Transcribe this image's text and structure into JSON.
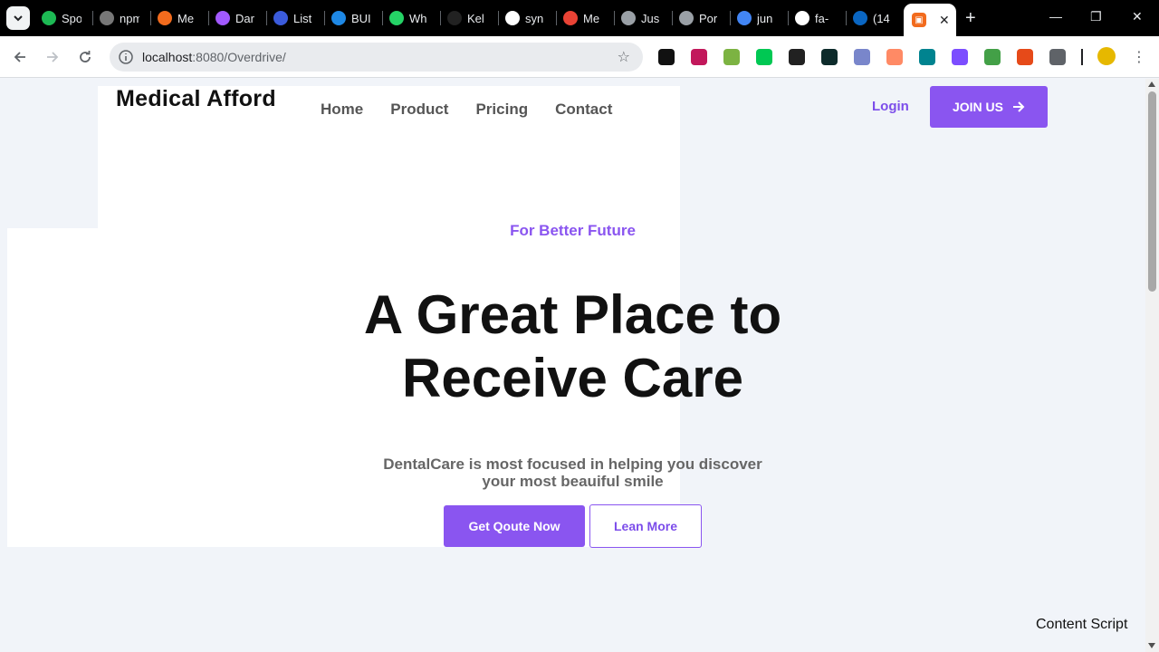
{
  "browser": {
    "tabs": [
      {
        "label": "Spo",
        "icon": "spotify-icon",
        "color": "#1db954"
      },
      {
        "label": "npm",
        "icon": "npm-icon",
        "color": "#777777"
      },
      {
        "label": "Me",
        "icon": "asterisk-icon",
        "color": "#f26b1d"
      },
      {
        "label": "Dar",
        "icon": "vite-icon",
        "color": "#a259ff"
      },
      {
        "label": "List",
        "icon": "droplet-icon",
        "color": "#3b5bdb"
      },
      {
        "label": "BUI",
        "icon": "hexagon-icon",
        "color": "#1e88e5"
      },
      {
        "label": "Wh",
        "icon": "whatsapp-icon",
        "color": "#25d366"
      },
      {
        "label": "Kel",
        "icon": "sparkle-icon",
        "color": "#222222"
      },
      {
        "label": "syn",
        "icon": "github-icon",
        "color": "#ffffff"
      },
      {
        "label": "Me",
        "icon": "gmail-icon",
        "color": "#ea4335"
      },
      {
        "label": "Jus",
        "icon": "globe-icon",
        "color": "#9aa0a6"
      },
      {
        "label": "Por",
        "icon": "globe-icon",
        "color": "#9aa0a6"
      },
      {
        "label": "jun",
        "icon": "google-icon",
        "color": "#4285f4"
      },
      {
        "label": "fa-",
        "icon": "flag-icon",
        "color": "#ffffff"
      },
      {
        "label": "(14",
        "icon": "linkedin-icon",
        "color": "#0a66c2"
      }
    ],
    "active_tab": {
      "icon": "active-tab-icon",
      "color": "#f26b1d"
    },
    "url_host": "localhost",
    "url_path": ":8080/Overdrive/",
    "extensions": [
      {
        "icon": "ext-pen-icon",
        "color": "#111111"
      },
      {
        "icon": "ext-play-icon",
        "color": "#c2185b"
      },
      {
        "icon": "ext-chart-icon",
        "color": "#7cb342"
      },
      {
        "icon": "ext-grid-icon",
        "color": "#00c853"
      },
      {
        "icon": "ext-dots-icon",
        "color": "#212121"
      },
      {
        "icon": "ext-hash-icon",
        "color": "#0d2b2b"
      },
      {
        "icon": "ext-cloud-icon",
        "color": "#7986cb"
      },
      {
        "icon": "ext-wave-icon",
        "color": "#ff8a65"
      },
      {
        "icon": "ext-turtle-icon",
        "color": "#00838f"
      },
      {
        "icon": "ext-calendar-icon",
        "color": "#7c4dff"
      },
      {
        "icon": "ext-diamond-icon",
        "color": "#43a047"
      },
      {
        "icon": "ext-fox-icon",
        "color": "#e64a19"
      },
      {
        "icon": "ext-puzzle-icon",
        "color": "#5f6368"
      }
    ]
  },
  "site": {
    "logo": "Medical Afford",
    "nav": [
      "Home",
      "Product",
      "Pricing",
      "Contact"
    ],
    "login": "Login",
    "join": "JOIN US",
    "eyebrow": "For Better Future",
    "headline_1": "A Great Place to",
    "headline_2": "Receive Care",
    "sub_1": "DentalCare is most focused in helping you discover",
    "sub_2": "your most beauiful smile",
    "cta_primary": "Get Qoute Now",
    "cta_secondary": "Lean More",
    "content_script": "Content Script",
    "accent": "#8a55f0"
  }
}
